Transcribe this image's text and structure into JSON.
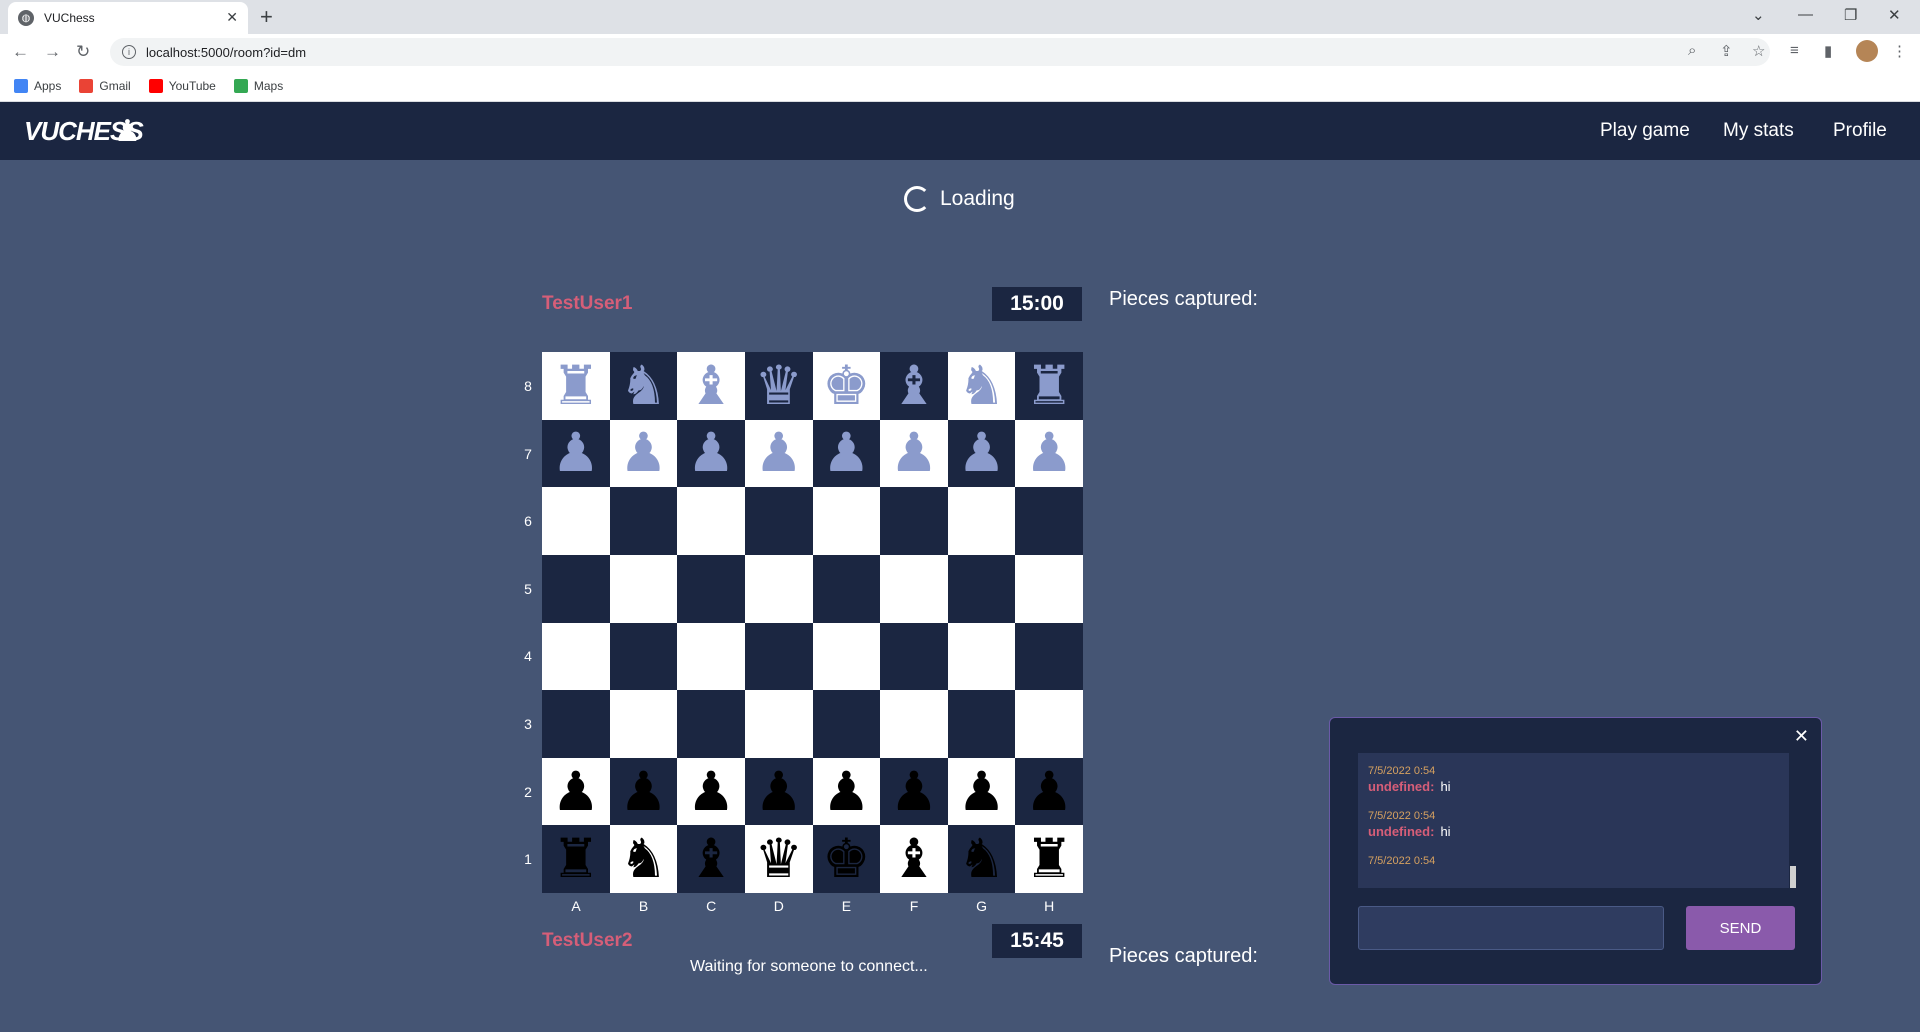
{
  "browser": {
    "tab_title": "VUChess",
    "url": "localhost:5000/room?id=dm",
    "bookmarks": [
      "Apps",
      "Gmail",
      "YouTube",
      "Maps"
    ]
  },
  "header": {
    "logo": "VUCHESS",
    "nav": [
      "Play game",
      "My stats",
      "Profile"
    ]
  },
  "status": {
    "loading": "Loading",
    "waiting": "Waiting for someone to connect..."
  },
  "players": {
    "top": {
      "name": "TestUser1",
      "time": "15:00",
      "captured_label": "Pieces captured:"
    },
    "bottom": {
      "name": "TestUser2",
      "time": "15:45",
      "captured_label": "Pieces captured:"
    }
  },
  "board": {
    "ranks": [
      "8",
      "7",
      "6",
      "5",
      "4",
      "3",
      "2",
      "1"
    ],
    "files": [
      "A",
      "B",
      "C",
      "D",
      "E",
      "F",
      "G",
      "H"
    ],
    "rows": [
      [
        "♜",
        "♞",
        "♝",
        "♛",
        "♚",
        "♝",
        "♞",
        "♜"
      ],
      [
        "♟",
        "♟",
        "♟",
        "♟",
        "♟",
        "♟",
        "♟",
        "♟"
      ],
      [
        "",
        "",
        "",
        "",
        "",
        "",
        "",
        ""
      ],
      [
        "",
        "",
        "",
        "",
        "",
        "",
        "",
        ""
      ],
      [
        "",
        "",
        "",
        "",
        "",
        "",
        "",
        ""
      ],
      [
        "",
        "",
        "",
        "",
        "",
        "",
        "",
        ""
      ],
      [
        "♟",
        "♟",
        "♟",
        "♟",
        "♟",
        "♟",
        "♟",
        "♟"
      ],
      [
        "♜",
        "♞",
        "♝",
        "♛",
        "♚",
        "♝",
        "♞",
        "♜"
      ]
    ]
  },
  "chat": {
    "messages": [
      {
        "time": "7/5/2022 0:54",
        "user": "undefined:",
        "text": "hi"
      },
      {
        "time": "7/5/2022 0:54",
        "user": "undefined:",
        "text": "hi"
      },
      {
        "time": "7/5/2022 0:54",
        "user": "",
        "text": ""
      }
    ],
    "input_value": "",
    "send_label": "SEND"
  }
}
